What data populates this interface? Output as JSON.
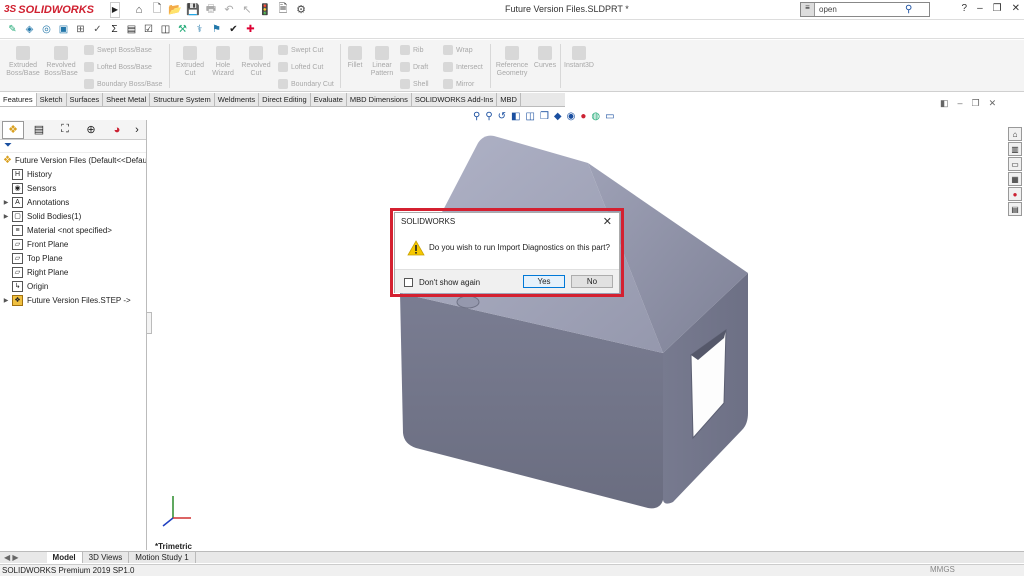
{
  "app": {
    "brand_ds": "3S",
    "brand_name": "SOLIDWORKS",
    "window_title": "Future Version Files.SLDPRT *",
    "search_value": "open"
  },
  "command_manager": {
    "items": [
      {
        "label": "Extruded\nBoss/Base"
      },
      {
        "label": "Revolved\nBoss/Base"
      },
      {
        "label": "Extruded\nCut"
      },
      {
        "label": "Hole\nWizard"
      },
      {
        "label": "Revolved\nCut"
      },
      {
        "label": "Fillet"
      },
      {
        "label": "Linear\nPattern"
      },
      {
        "label": "Reference\nGeometry"
      },
      {
        "label": "Curves"
      },
      {
        "label": "Instant3D"
      }
    ],
    "small_items": [
      {
        "label": "Swept Boss/Base"
      },
      {
        "label": "Lofted Boss/Base"
      },
      {
        "label": "Boundary Boss/Base"
      },
      {
        "label": "Swept Cut"
      },
      {
        "label": "Lofted Cut"
      },
      {
        "label": "Boundary Cut"
      },
      {
        "label": "Rib"
      },
      {
        "label": "Draft"
      },
      {
        "label": "Shell"
      },
      {
        "label": "Wrap"
      },
      {
        "label": "Intersect"
      },
      {
        "label": "Mirror"
      }
    ]
  },
  "tabs": [
    "Features",
    "Sketch",
    "Surfaces",
    "Sheet Metal",
    "Structure System",
    "Weldments",
    "Direct Editing",
    "Evaluate",
    "MBD Dimensions",
    "SOLIDWORKS Add-Ins",
    "MBD"
  ],
  "tree": {
    "root": "Future Version Files  (Default<<Default",
    "items": [
      {
        "label": "History",
        "expand": ""
      },
      {
        "label": "Sensors",
        "expand": ""
      },
      {
        "label": "Annotations",
        "expand": "▶"
      },
      {
        "label": "Solid Bodies(1)",
        "expand": "▶"
      },
      {
        "label": "Material <not specified>",
        "expand": ""
      },
      {
        "label": "Front Plane",
        "expand": ""
      },
      {
        "label": "Top Plane",
        "expand": ""
      },
      {
        "label": "Right Plane",
        "expand": ""
      },
      {
        "label": "Origin",
        "expand": ""
      },
      {
        "label": "Future Version Files.STEP ->",
        "expand": "▶"
      }
    ]
  },
  "view": {
    "orientation": "*Trimetric"
  },
  "bottom_tabs": [
    "Model",
    "3D Views",
    "Motion Study 1"
  ],
  "status": {
    "text": "SOLIDWORKS Premium 2019 SP1.0",
    "units": "MMGS"
  },
  "dialog": {
    "title": "SOLIDWORKS",
    "message": "Do you wish to run Import Diagnostics on this part?",
    "checkbox_label": "Don't show again",
    "yes_label": "Yes",
    "no_label": "No"
  },
  "colors": {
    "brand_red": "#d02030",
    "highlight_red": "#d42030",
    "model_gray": "#8a8ea3"
  }
}
